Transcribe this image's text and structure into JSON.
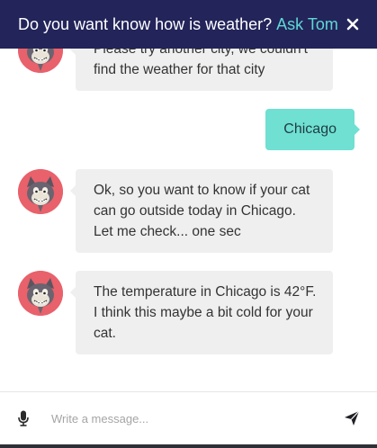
{
  "header": {
    "question": "Do you want know how is weather?",
    "link": "Ask Tom",
    "close_icon": "close-icon"
  },
  "messages": [
    {
      "sender": "bot",
      "text": "Please try another city, we couldn't find the weather for that city"
    },
    {
      "sender": "user",
      "text": "Chicago"
    },
    {
      "sender": "bot",
      "text": "Ok, so you want to know if your cat can go outside today in Chicago. Let me check... one sec"
    },
    {
      "sender": "bot",
      "text": "The temperature in Chicago is 42°F. I think this maybe a bit cold for your cat."
    }
  ],
  "composer": {
    "placeholder": "Write a message...",
    "value": "",
    "mic_icon": "microphone-icon",
    "send_icon": "send-icon"
  },
  "colors": {
    "header_bg": "#23245a",
    "accent": "#5ed8d4",
    "user_bubble": "#6fe0d2",
    "bot_bubble": "#efefef",
    "avatar_bg": "#e8616b"
  }
}
